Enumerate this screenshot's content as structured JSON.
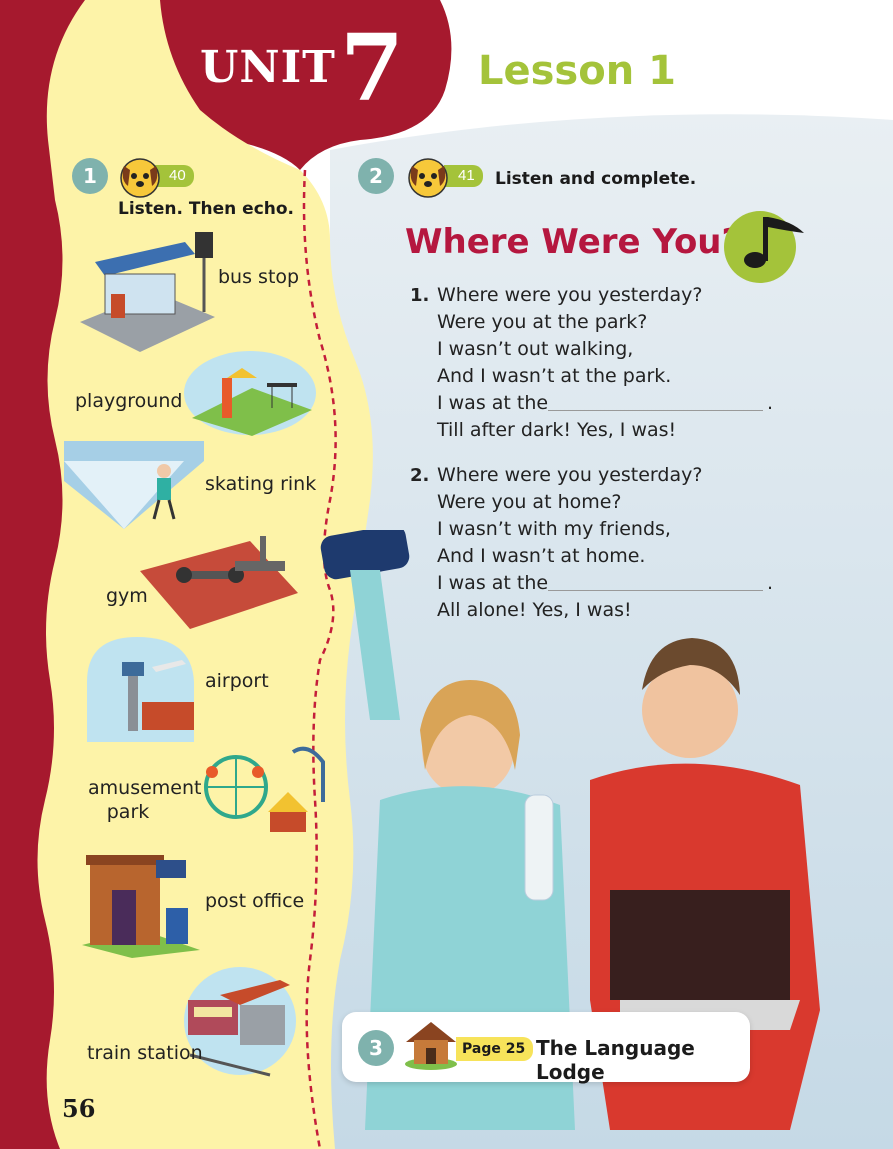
{
  "header": {
    "unit_word": "UNIT",
    "unit_number": "7",
    "lesson": "Lesson 1"
  },
  "activity1": {
    "number": "1",
    "track": "40",
    "instruction": "Listen. Then echo.",
    "vocabulary": [
      {
        "label": "bus stop",
        "icon": "bus-stop-illustration"
      },
      {
        "label": "playground",
        "icon": "playground-illustration"
      },
      {
        "label": "skating rink",
        "icon": "skating-rink-illustration"
      },
      {
        "label": "gym",
        "icon": "gym-illustration"
      },
      {
        "label": "airport",
        "icon": "airport-illustration"
      },
      {
        "label": "amusement park",
        "icon": "amusement-park-illustration"
      },
      {
        "label": "post office",
        "icon": "post-office-illustration"
      },
      {
        "label": "train station",
        "icon": "train-station-illustration"
      }
    ]
  },
  "activity2": {
    "number": "2",
    "track": "41",
    "instruction": "Listen and complete.",
    "song_title": "Where Were You?",
    "verses": [
      {
        "number": "1.",
        "lines": [
          "Where were you yesterday?",
          "Were you at the park?",
          "I wasn’t out walking,",
          "And I wasn’t at the park.",
          "I was at the",
          "Till after dark! Yes, I was!"
        ],
        "blank_end": "."
      },
      {
        "number": "2.",
        "lines": [
          "Where were you yesterday?",
          "Were you at home?",
          "I wasn’t with my friends,",
          "And I wasn’t at home.",
          "I was at the",
          "All alone! Yes, I was!"
        ],
        "blank_end": "."
      }
    ]
  },
  "activity3": {
    "number": "3",
    "page_ref": "Page 25",
    "title": "The Language Lodge"
  },
  "page_number": "56",
  "colors": {
    "maroon": "#a6192e",
    "cream": "#fdf3a8",
    "green_accent": "#a4c33a",
    "teal_circle": "#7fb2ad",
    "title_red": "#b5173f"
  }
}
